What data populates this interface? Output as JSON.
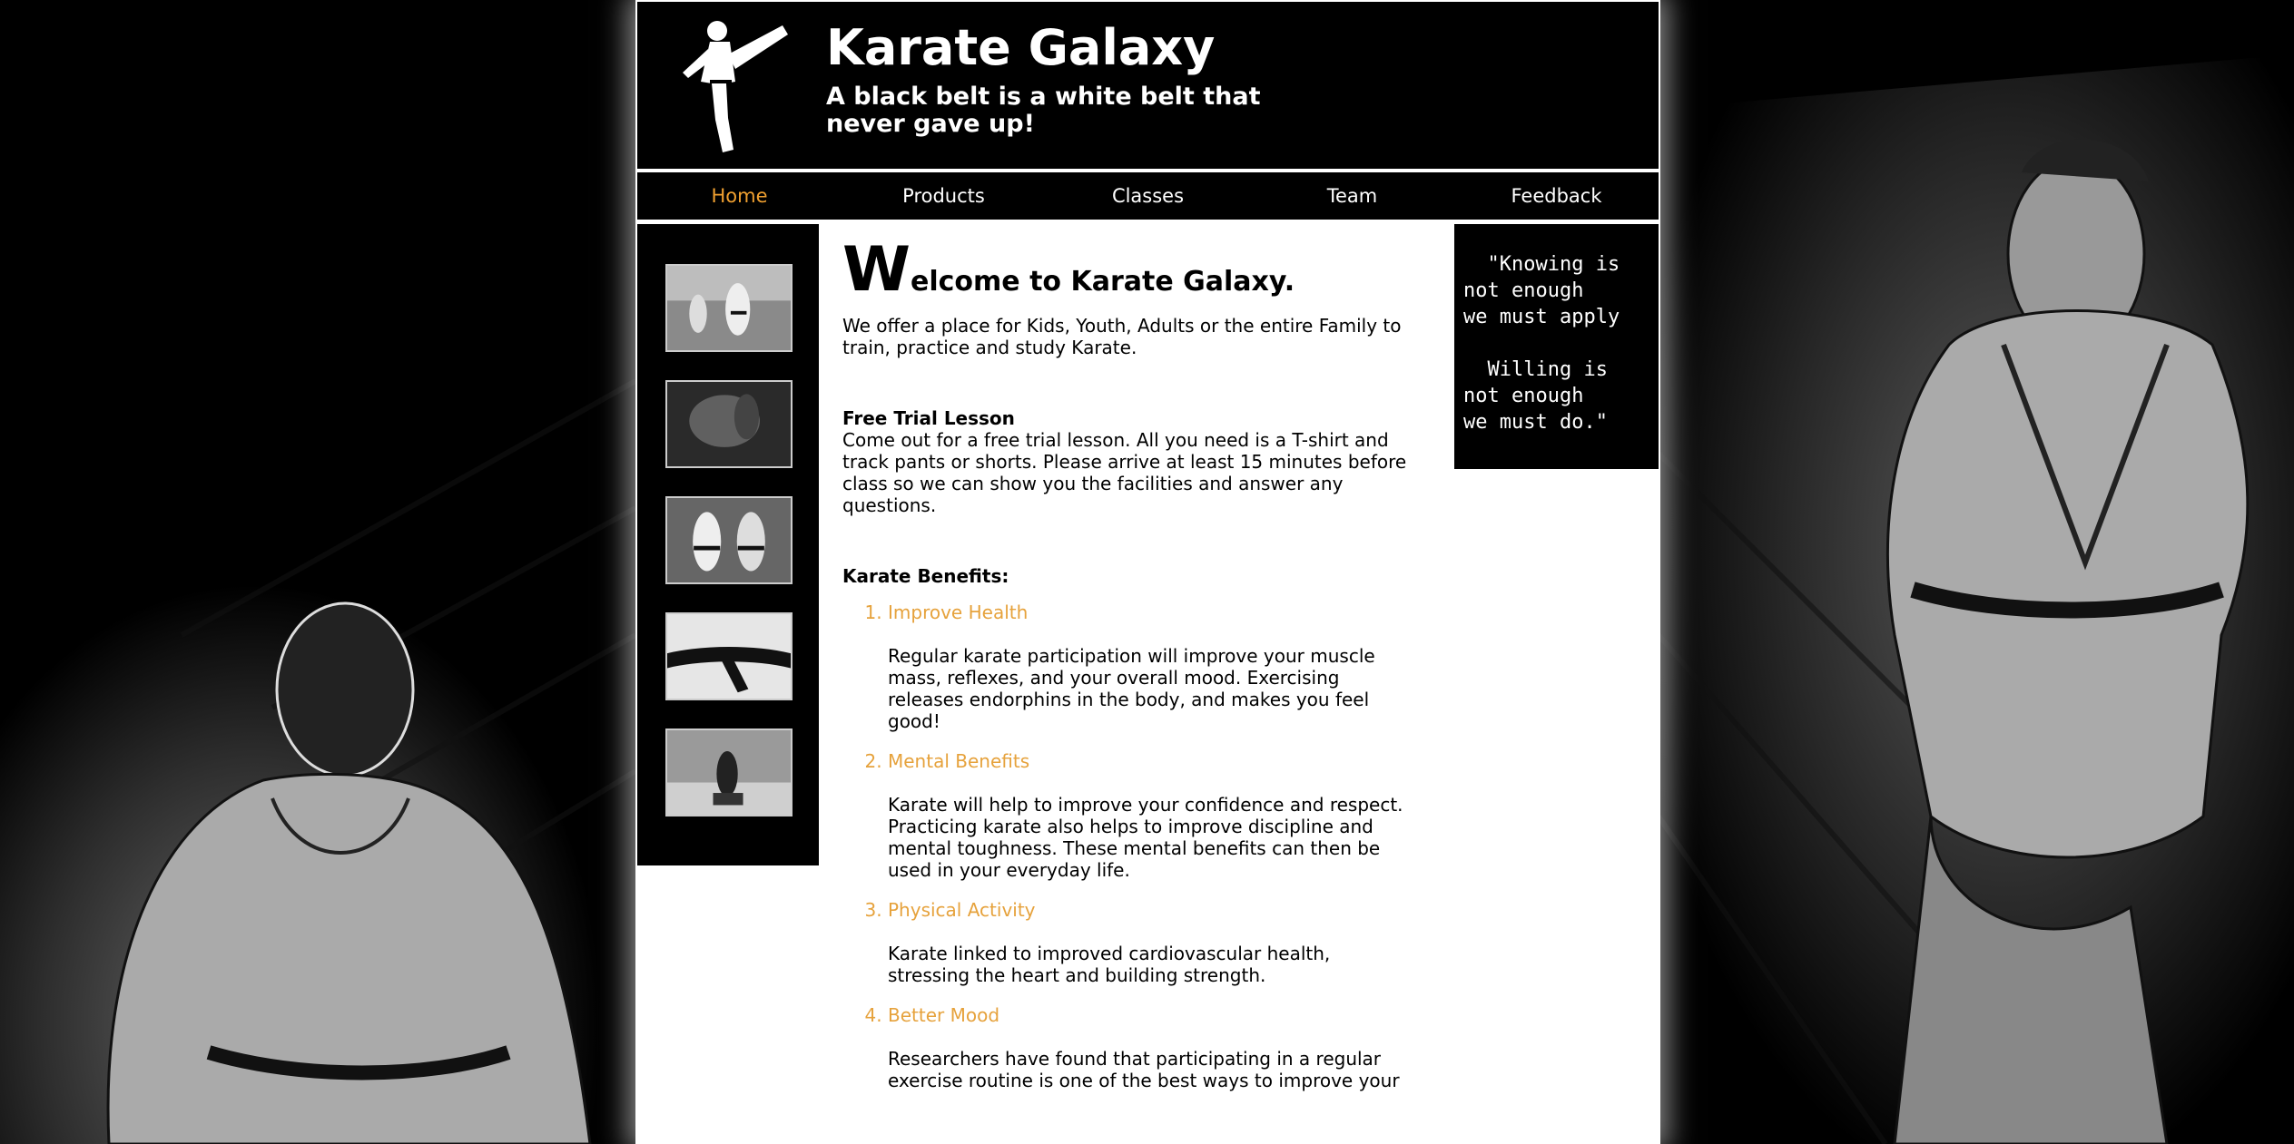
{
  "header": {
    "title": "Karate Galaxy",
    "tagline": "A black belt is a white belt that never gave up!"
  },
  "nav": {
    "items": [
      "Home",
      "Products",
      "Classes",
      "Team",
      "Feedback"
    ],
    "active": "Home"
  },
  "gallery": {
    "images": [
      "karate-class-photo",
      "karate-fighter-photo",
      "karate-sparring-photo",
      "black-belt-photo",
      "kneeling-karateka-photo"
    ]
  },
  "main": {
    "welcome_initial": "W",
    "welcome_rest": "elcome to Karate Galaxy.",
    "intro": "We offer a place for Kids, Youth, Adults or the entire Family to train, practice and study Karate.",
    "trial_title": "Free Trial Lesson",
    "trial_text": "Come out for a free trial lesson. All you need is a T-shirt and track pants or shorts. Please arrive at least 15 minutes before class so we can show you the facilities and answer any questions.",
    "benefits_title": "Karate Benefits:",
    "benefits": [
      {
        "name": "Improve Health",
        "text": "Regular karate participation will improve your muscle mass, reflexes, and your overall mood. Exercising releases endorphins in the body, and makes you feel good!"
      },
      {
        "name": "Mental Benefits",
        "text": "Karate will help to improve your confidence and respect. Practicing karate also helps to improve discipline and mental toughness. These mental benefits can then be used in your everyday life."
      },
      {
        "name": "Physical Activity",
        "text": "Karate linked to improved cardiovascular health, stressing the heart and building strength."
      },
      {
        "name": "Better Mood",
        "text": "Researchers have found that participating in a regular exercise routine is one of the best ways to improve your"
      }
    ]
  },
  "quote": {
    "text": "  \"Knowing is\nnot enough\nwe must apply\n\n  Willing is\nnot enough\nwe must do.\""
  },
  "colors": {
    "accent": "#e6a23c",
    "header_bg": "#000000",
    "page_bg": "#ffffff"
  }
}
